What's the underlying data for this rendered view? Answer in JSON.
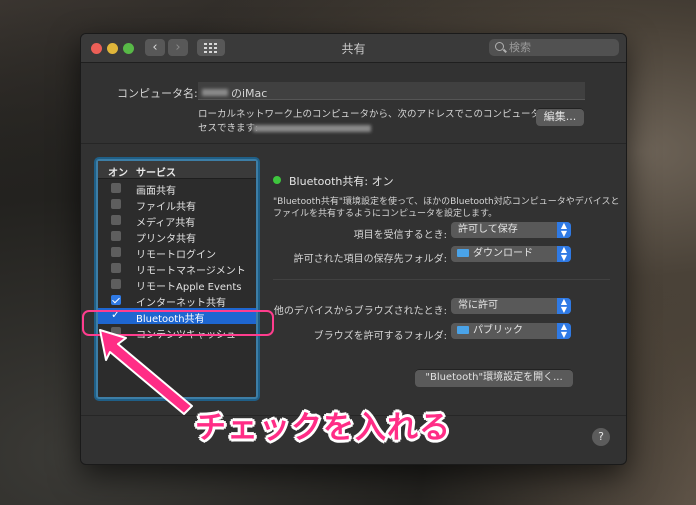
{
  "window": {
    "title": "共有"
  },
  "search": {
    "placeholder": "検索"
  },
  "computer": {
    "label": "コンピュータ名:",
    "name_suffix": "のiMac",
    "address_line1": "ローカルネットワーク上のコンピュータから、次のアドレスでこのコンピュータにアク",
    "address_line2": "セスできます:",
    "edit_button": "編集..."
  },
  "services": {
    "col_on": "オン",
    "col_service": "サービス",
    "items": [
      {
        "label": "画面共有",
        "checked": false
      },
      {
        "label": "ファイル共有",
        "checked": false
      },
      {
        "label": "メディア共有",
        "checked": false
      },
      {
        "label": "プリンタ共有",
        "checked": false
      },
      {
        "label": "リモートログイン",
        "checked": false
      },
      {
        "label": "リモートマネージメント",
        "checked": false
      },
      {
        "label": "リモートApple Events",
        "checked": false
      },
      {
        "label": "インターネット共有",
        "checked": true
      },
      {
        "label": "Bluetooth共有",
        "checked": true,
        "selected": true
      },
      {
        "label": "コンテンツキャッシュ",
        "checked": false
      }
    ]
  },
  "detail": {
    "status": "Bluetooth共有: オン",
    "desc_line1": "\"Bluetooth共有\"環境設定を使って、ほかのBluetooth対応コンピュータやデバイスと",
    "desc_line2": "ファイルを共有するようにコンピュータを設定します。",
    "receive_label": "項目を受信するとき:",
    "receive_value": "許可して保存",
    "folder_label": "許可された項目の保存先フォルダ:",
    "folder_value": "ダウンロード",
    "browse_label": "他のデバイスからブラウズされたとき:",
    "browse_value": "常に許可",
    "browse_folder_label": "ブラウズを許可するフォルダ:",
    "browse_folder_value": "パブリック",
    "open_prefs_button": "\"Bluetooth\"環境設定を開く..."
  },
  "help": {
    "label": "?"
  },
  "annotation": {
    "text": "チェックを入れる",
    "color": "#ff2d86"
  }
}
